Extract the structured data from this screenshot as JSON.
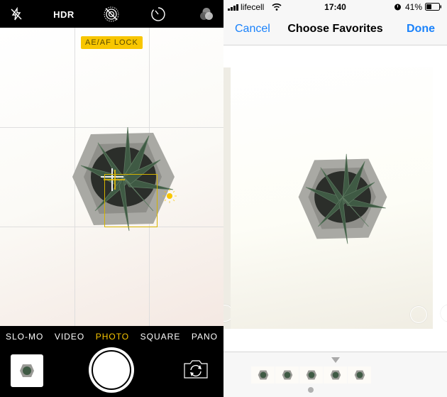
{
  "camera": {
    "topbar": {
      "flash_icon": "flash-off-icon",
      "hdr_label": "HDR",
      "live_icon": "live-photo-off-icon",
      "timer_icon": "timer-icon",
      "filters_icon": "filters-icon"
    },
    "ae_af_lock_label": "AE/AF LOCK",
    "modes": [
      {
        "label": "SLO-MO",
        "active": false
      },
      {
        "label": "VIDEO",
        "active": false
      },
      {
        "label": "PHOTO",
        "active": true
      },
      {
        "label": "SQUARE",
        "active": false
      },
      {
        "label": "PANO",
        "active": false
      }
    ],
    "accent_color": "#f8c600"
  },
  "favorites": {
    "status_bar": {
      "carrier": "lifecell",
      "time": "17:40",
      "battery": "41%",
      "battery_level": 0.41
    },
    "nav": {
      "cancel_label": "Cancel",
      "title": "Choose Favorites",
      "done_label": "Done"
    },
    "burst_count": 5,
    "selected_index": 2,
    "accent_color": "#1a82fb"
  }
}
